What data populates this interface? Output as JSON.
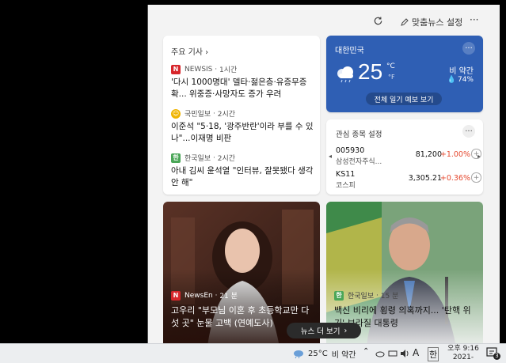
{
  "toolbar": {
    "personalize_label": "맞춤뉴스 설정",
    "more_label": "···"
  },
  "top_stories": {
    "heading": "주요 기사",
    "chevron": "›",
    "stories": [
      {
        "source": "NEWSIS",
        "time": "1시간",
        "logo_text": "N",
        "logo_color": "#d7262b",
        "headline": "'다시 1000명대' 델타·젊은층·유증무증확... 위중증·사망자도 증가 우려"
      },
      {
        "source": "국민일보",
        "time": "2시간",
        "logo_text": "☺",
        "logo_color": "#f0b400",
        "headline": "이준석 \"5·18, '광주반란'이라 부를 수 있나\"...이재명 비판"
      },
      {
        "source": "한국일보",
        "time": "2시간",
        "logo_text": "한",
        "logo_color": "#4aa657",
        "headline": "아내 김씨 윤석열 \"인터뷰, 잘못됐다 생각 안 해\""
      }
    ]
  },
  "weather": {
    "location": "대한민국",
    "temperature": "25",
    "unit_c": "°C",
    "unit_f": "°F",
    "condition": "비 약간",
    "precip": "74%",
    "forecast_button": "전체 일기 예보 보기",
    "more_label": "···"
  },
  "stocks": {
    "heading": "관심 종목 설정",
    "more_label": "···",
    "rows": [
      {
        "ticker": "005930",
        "name": "삼성전자주식...",
        "price": "81,200",
        "change": "+1.00%"
      },
      {
        "ticker": "KS11",
        "name": "코스피",
        "price": "3,305.21",
        "change": "+0.36%"
      }
    ],
    "left_arrow": "◂",
    "right_arrow": "▸",
    "plus": "+"
  },
  "image_stories": [
    {
      "source": "NewsEn",
      "time": "21 분",
      "logo_text": "N",
      "logo_color": "#d7262b",
      "headline": "고우리 \"부모님 이혼 후 초등학교만 다섯 곳\" 눈물 고백 (연예도사)"
    },
    {
      "source": "한국일보",
      "time": "15 분",
      "logo_text": "한",
      "logo_color": "#4aa657",
      "headline": "백신 비리에 횡령 의혹까지... '탄핵 위기' 브라질 대통령"
    }
  ],
  "more_news_button": "뉴스 더 보기",
  "more_news_chevron": "›",
  "taskbar": {
    "weather_temp": "25°C",
    "weather_cond": "비 약간",
    "ime_a": "A",
    "ime_han": "한",
    "time": "오후 9:16",
    "date": "2021-",
    "notif_count": "3"
  },
  "colors": {
    "weather_blue": "#2f5fb4",
    "stock_up": "#e5482e"
  }
}
